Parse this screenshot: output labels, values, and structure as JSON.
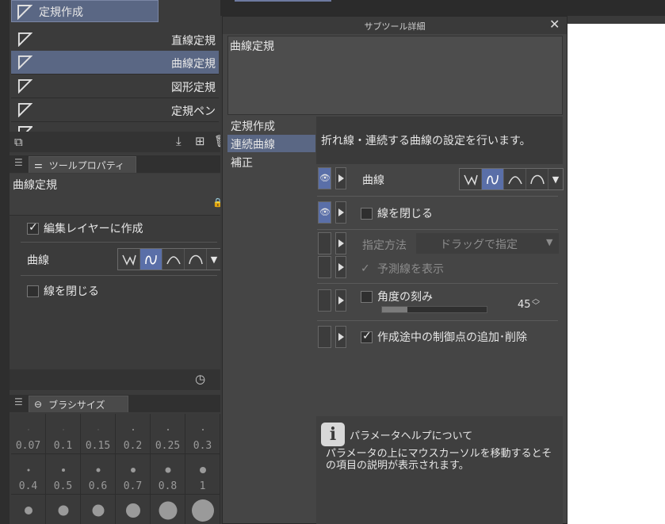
{
  "tool_list": {
    "header_item": "定規作成",
    "items": [
      {
        "label": "直線定規",
        "selected": false
      },
      {
        "label": "曲線定規",
        "selected": true
      },
      {
        "label": "図形定規",
        "selected": false
      },
      {
        "label": "定規ペン",
        "selected": false
      }
    ]
  },
  "tool_property": {
    "tab_label": "ツールプロパティ",
    "tool_name": "曲線定規",
    "create_on_edit_layer": "編集レイヤーに作成",
    "curve_label": "曲線",
    "close_line_label": "線を閉じる"
  },
  "brush_size": {
    "tab_label": "ブラシサイズ",
    "sizes": [
      "0.07",
      "0.1",
      "0.15",
      "0.2",
      "0.25",
      "0.3",
      "0.4",
      "0.5",
      "0.6",
      "0.7",
      "0.8",
      "1"
    ]
  },
  "dialog": {
    "title": "サブツール詳細",
    "tool_name": "曲線定規",
    "categories": [
      {
        "label": "定規作成",
        "selected": false
      },
      {
        "label": "連続曲線",
        "selected": true
      },
      {
        "label": "補正",
        "selected": false
      }
    ],
    "description": "折れ線・連続する曲線の設定を行います。",
    "settings": {
      "curve": "曲線",
      "close_line": "線を閉じる",
      "specify_method": "指定方法",
      "specify_method_value": "ドラッグで指定",
      "show_prediction": "予測線を表示",
      "angle_step": "角度の刻み",
      "angle_value": "45",
      "add_delete_points": "作成途中の制御点の追加･削除"
    },
    "help_title": "パラメータヘルプについて",
    "help_text": "パラメータの上にマウスカーソルを移動するとその項目の説明が表示されます。"
  },
  "colors": {
    "accent": "#5a6fa8",
    "selected_row": "#5a6784"
  }
}
